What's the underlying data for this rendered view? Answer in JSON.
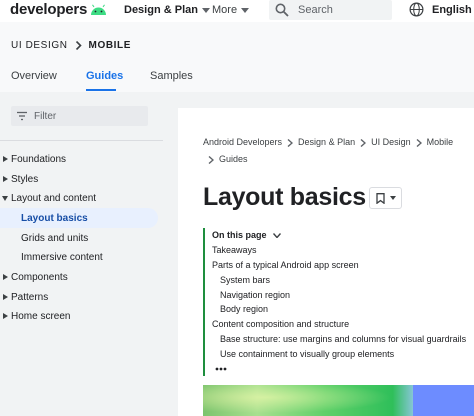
{
  "topbar": {
    "logo_text": "developers",
    "nav": [
      {
        "label": "Design & Plan",
        "active": true
      },
      {
        "label": "More",
        "active": false
      }
    ],
    "search_placeholder": "Search",
    "language": "English"
  },
  "section": {
    "crumbs": [
      "UI DESIGN",
      "MOBILE"
    ],
    "tabs": [
      "Overview",
      "Guides",
      "Samples"
    ],
    "active_tab": "Guides"
  },
  "leftnav": {
    "filter_placeholder": "Filter",
    "items": [
      {
        "label": "Foundations",
        "level": 0,
        "arrow": "right"
      },
      {
        "label": "Styles",
        "level": 0,
        "arrow": "right"
      },
      {
        "label": "Layout and content",
        "level": 0,
        "arrow": "down"
      },
      {
        "label": "Layout basics",
        "level": 1,
        "selected": true
      },
      {
        "label": "Grids and units",
        "level": 1
      },
      {
        "label": "Immersive content",
        "level": 1
      },
      {
        "label": "Components",
        "level": 0,
        "arrow": "right"
      },
      {
        "label": "Patterns",
        "level": 0,
        "arrow": "right"
      },
      {
        "label": "Home screen",
        "level": 0,
        "arrow": "right"
      }
    ]
  },
  "content": {
    "breadcrumb": [
      "Android Developers",
      "Design & Plan",
      "UI Design",
      "Mobile",
      "Guides"
    ],
    "title": "Layout basics",
    "toc": {
      "heading": "On this page",
      "items": [
        {
          "label": "Takeaways",
          "level": 0
        },
        {
          "label": "Parts of a typical Android app screen",
          "level": 0
        },
        {
          "label": "System bars",
          "level": 1
        },
        {
          "label": "Navigation region",
          "level": 1
        },
        {
          "label": "Body region",
          "level": 1
        },
        {
          "label": "Content composition and structure",
          "level": 0
        },
        {
          "label": "Base structure: use margins and columns for visual guardrails",
          "level": 1
        },
        {
          "label": "Use containment to visually group elements",
          "level": 1
        }
      ]
    }
  },
  "colors": {
    "accent": "#1a73e8",
    "toc_bar": "#1e8e3e",
    "android_green": "#3ddc84"
  }
}
